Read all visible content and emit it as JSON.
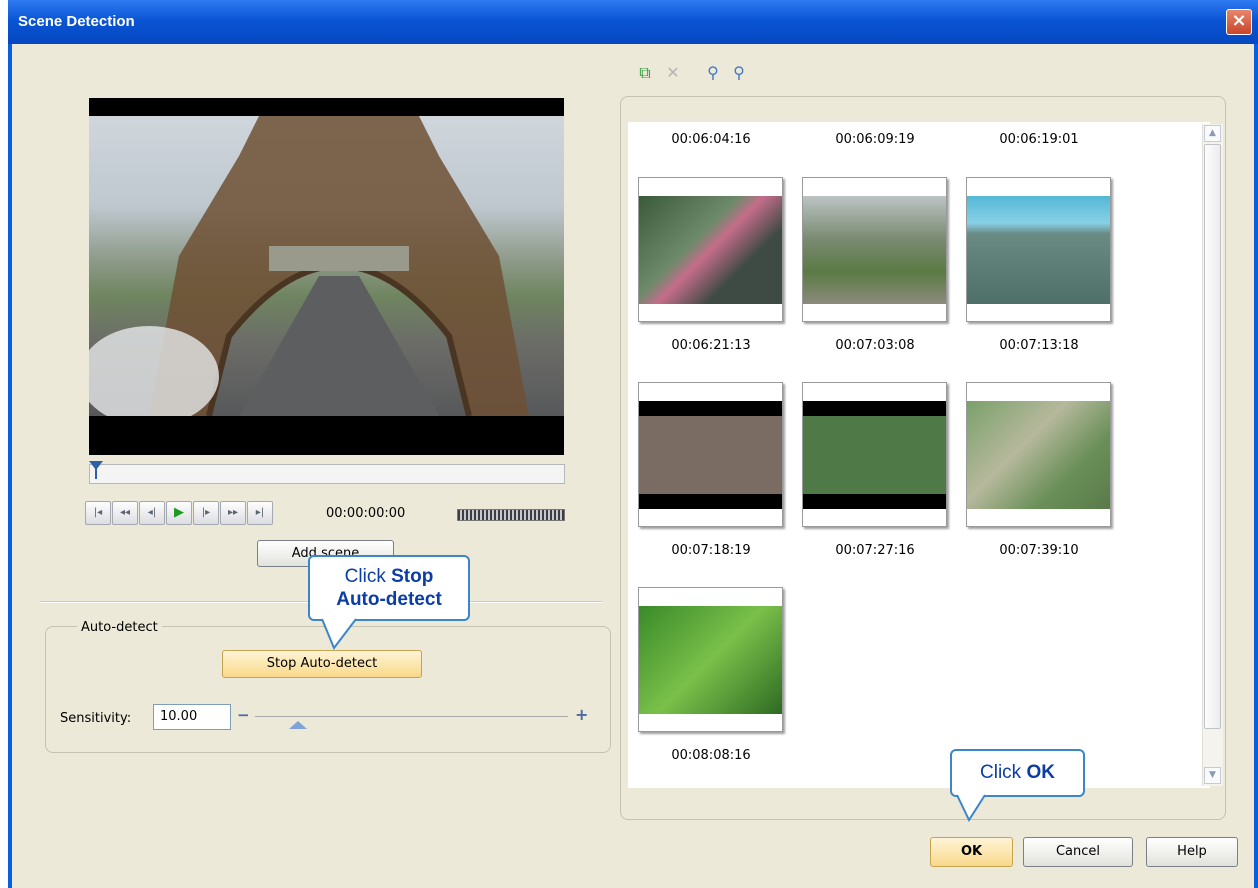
{
  "window": {
    "title": "Scene Detection",
    "close_label": "×"
  },
  "player": {
    "timecode": "00:00:00:00",
    "controls": [
      "|◂",
      "◂◂",
      "◂|",
      "▶",
      "|▸",
      "▸▸",
      "▸|"
    ],
    "add_scene_label": "Add scene"
  },
  "auto_detect": {
    "group_label": "Auto-detect",
    "stop_button_label": "Stop Auto-detect",
    "sensitivity_label": "Sensitivity:",
    "sensitivity_value": "10.00",
    "minus_label": "−",
    "plus_label": "+"
  },
  "toolbar": {
    "icons": [
      "merge-icon",
      "delete-icon",
      "zoom-in-icon",
      "zoom-out-icon"
    ]
  },
  "scenes": {
    "header_times": [
      "00:06:04:16",
      "00:06:09:19",
      "00:06:19:01"
    ],
    "items": [
      {
        "time": "00:06:21:13"
      },
      {
        "time": "00:07:03:08"
      },
      {
        "time": "00:07:13:18"
      },
      {
        "time": "00:07:18:19"
      },
      {
        "time": "00:07:27:16"
      },
      {
        "time": "00:07:39:10"
      },
      {
        "time": "00:08:08:16"
      }
    ]
  },
  "buttons": {
    "ok": "OK",
    "cancel": "Cancel",
    "help": "Help"
  },
  "callouts": {
    "stop": {
      "prefix": "Click ",
      "bold1": "Stop",
      "bold2": "Auto-detect"
    },
    "ok": {
      "prefix": "Click ",
      "bold": "OK"
    }
  },
  "colors": {
    "title_bar": "#0a55d4",
    "dialog_bg": "#ece9d8",
    "callout_border": "#3a86c8",
    "callout_text": "#0a3da8"
  }
}
